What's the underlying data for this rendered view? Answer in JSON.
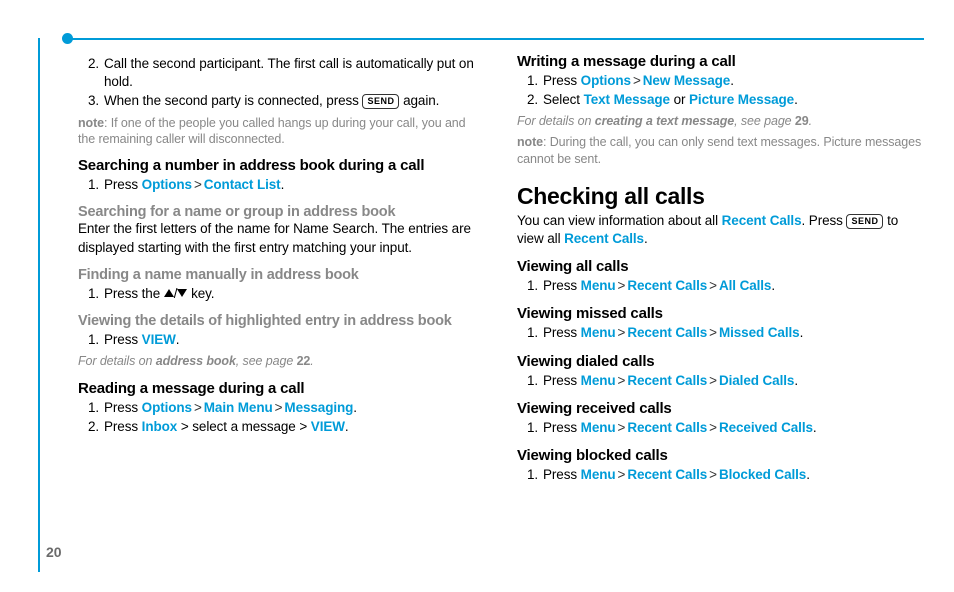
{
  "page_number": "20",
  "left": {
    "steps_continue": [
      "Call the second participant. The first call is automatically put on hold.",
      "When the second party is connected, press "
    ],
    "send_suffix": " again.",
    "note1": ": If one of the people you called hangs up during your call, you and the remaining caller will disconnected.",
    "note_label": "note",
    "h_search_num": "Searching a number in address book during a call",
    "search_num_step_prefix": "Press ",
    "options": "Options",
    "contact_list": "Contact List",
    "h_search_name": "Searching for a name or group in address book",
    "search_name_text": "Enter the first letters of the name for Name Search. The entries are displayed starting with the first entry matching your input.",
    "h_find_manual": "Finding a name manually in address book",
    "find_manual_prefix": "Press the ",
    "find_manual_suffix": " key.",
    "h_view_details": "Viewing the details of highlighted entry in address book",
    "view_details_prefix": "Press ",
    "view": "VIEW",
    "xref1_a": "For details on ",
    "xref1_b": "address book",
    "xref1_c": ", see page ",
    "xref1_pg": "22",
    "h_read_msg": "Reading a message during a call",
    "read1_prefix": "Press ",
    "main_menu": "Main Menu",
    "messaging": "Messaging",
    "read2_prefix": "Press ",
    "inbox": "Inbox",
    "read2_mid": " > select a message > "
  },
  "right": {
    "h_write_msg": "Writing a message during a call",
    "w1_prefix": "Press ",
    "options": "Options",
    "new_message": "New Message",
    "w2_prefix": "Select ",
    "text_message": "Text Message",
    "or": " or ",
    "picture_message": "Picture Message",
    "xref2_a": "For details on ",
    "xref2_b": "creating a text message",
    "xref2_c": ", see page ",
    "xref2_pg": "29",
    "note_label": "note",
    "note2": ": During the call, you can only send text messages. Picture messages cannot be sent.",
    "h_checking": "Checking all calls",
    "intro_a": "You can view information about all ",
    "recent_calls": "Recent Calls",
    "intro_b": ". Press ",
    "intro_c": " to view all ",
    "h_view_all": "Viewing all calls",
    "menu": "Menu",
    "all_calls": "All Calls",
    "press": "Press ",
    "h_view_missed": "Viewing missed calls",
    "missed_calls": "Missed Calls",
    "h_view_dialed": "Viewing dialed calls",
    "dialed_calls": "Dialed Calls",
    "h_view_received": "Viewing received calls",
    "received_calls": "Received Calls",
    "h_view_blocked": "Viewing blocked calls",
    "blocked_calls": "Blocked Calls"
  },
  "key_send": "SEND"
}
